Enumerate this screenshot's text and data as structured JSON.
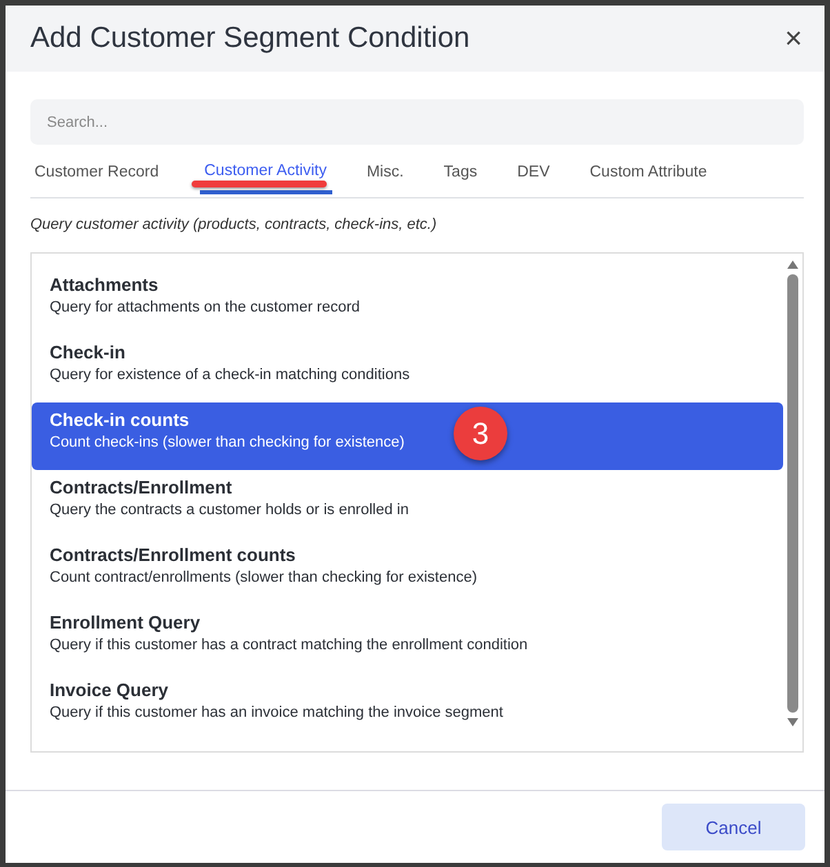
{
  "dialog": {
    "title": "Add Customer Segment Condition",
    "close": "×"
  },
  "search": {
    "placeholder": "Search..."
  },
  "tabs": [
    {
      "label": "Customer Record",
      "selected": false
    },
    {
      "label": "Customer Activity",
      "selected": true
    },
    {
      "label": "Misc.",
      "selected": false
    },
    {
      "label": "Tags",
      "selected": false
    },
    {
      "label": "DEV",
      "selected": false
    },
    {
      "label": "Custom Attribute",
      "selected": false
    }
  ],
  "description": "Query customer activity (products, contracts, check-ins, etc.)",
  "items": [
    {
      "title": "Attachments",
      "subtitle": "Query for attachments on the customer record",
      "selected": false
    },
    {
      "title": "Check-in",
      "subtitle": "Query for existence of a check-in matching conditions",
      "selected": false
    },
    {
      "title": "Check-in counts",
      "subtitle": "Count check-ins (slower than checking for existence)",
      "selected": true
    },
    {
      "title": "Contracts/Enrollment",
      "subtitle": "Query the contracts a customer holds or is enrolled in",
      "selected": false
    },
    {
      "title": "Contracts/Enrollment counts",
      "subtitle": "Count contract/enrollments (slower than checking for existence)",
      "selected": false
    },
    {
      "title": "Enrollment Query",
      "subtitle": "Query if this customer has a contract matching the enrollment condition",
      "selected": false
    },
    {
      "title": "Invoice Query",
      "subtitle": "Query if this customer has an invoice matching the invoice segment",
      "selected": false
    }
  ],
  "step_badge": "3",
  "buttons": [
    {
      "label": "Cancel"
    }
  ]
}
